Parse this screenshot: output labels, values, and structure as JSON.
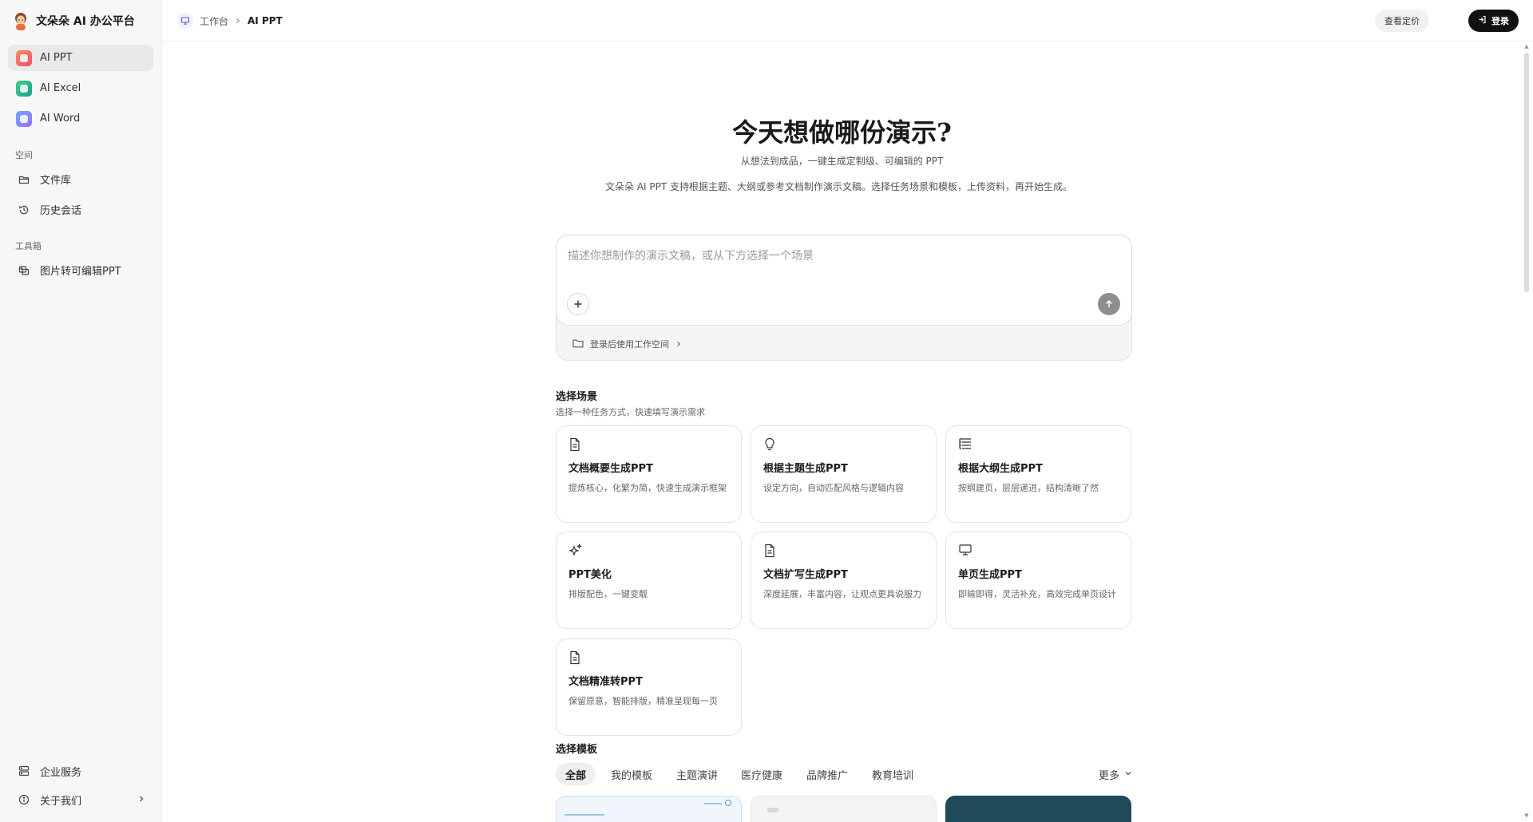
{
  "brand": {
    "name": "文朵朵 AI 办公平台"
  },
  "sidebar": {
    "apps": [
      {
        "label": "AI PPT",
        "color": "#f26b4f",
        "active": true
      },
      {
        "label": "AI Excel",
        "color": "#2bb673",
        "active": false
      },
      {
        "label": "AI Word",
        "color": "#4f8ef7",
        "active": false
      }
    ],
    "space_title": "空间",
    "space_items": [
      {
        "label": "文件库",
        "icon": "folder-icon"
      },
      {
        "label": "历史会话",
        "icon": "history-icon"
      }
    ],
    "tools_title": "工具箱",
    "tool_items": [
      {
        "label": "图片转可编辑PPT",
        "icon": "image-convert-icon"
      }
    ],
    "bottom_items": [
      {
        "label": "企业服务",
        "icon": "server-icon"
      },
      {
        "label": "关于我们",
        "icon": "info-icon"
      }
    ]
  },
  "topbar": {
    "breadcrumb_root": "工作台",
    "breadcrumb_current": "AI PPT",
    "pricing_label": "查看定价",
    "login_label": "登录"
  },
  "hero": {
    "title": "今天想做哪份演示?",
    "subtitle": "从想法到成品，一键生成定制级、可编辑的 PPT",
    "description": "文朵朵 AI PPT 支持根据主题、大纲或参考文档制作演示文稿。选择任务场景和模板，上传资料，再开始生成。"
  },
  "composer": {
    "placeholder": "描述你想制作的演示文稿，或从下方选择一个场景",
    "workspace_label": "登录后使用工作空间"
  },
  "scenes": {
    "title": "选择场景",
    "subtitle": "选择一种任务方式，快速填写演示需求",
    "cards": [
      {
        "title": "文档概要生成PPT",
        "desc": "提炼核心，化繁为简，快速生成演示框架",
        "icon": "document-icon"
      },
      {
        "title": "根据主题生成PPT",
        "desc": "设定方向，自动匹配风格与逻辑内容",
        "icon": "lightbulb-icon"
      },
      {
        "title": "根据大纲生成PPT",
        "desc": "按纲建页，层层递进，结构清晰了然",
        "icon": "outline-list-icon"
      },
      {
        "title": "PPT美化",
        "desc": "排版配色，一键变靓",
        "icon": "sparkle-icon"
      },
      {
        "title": "文档扩写生成PPT",
        "desc": "深度延展，丰富内容，让观点更具说服力",
        "icon": "document-icon"
      },
      {
        "title": "单页生成PPT",
        "desc": "即输即得，灵活补充，高效完成单页设计",
        "icon": "presentation-icon"
      },
      {
        "title": "文档精准转PPT",
        "desc": "保留原意，智能排版，精准呈现每一页",
        "icon": "document-icon"
      }
    ]
  },
  "templates": {
    "title": "选择模板",
    "tabs": [
      "全部",
      "我的模板",
      "主题演讲",
      "医疗健康",
      "品牌推广",
      "教育培训"
    ],
    "more_label": "更多"
  }
}
